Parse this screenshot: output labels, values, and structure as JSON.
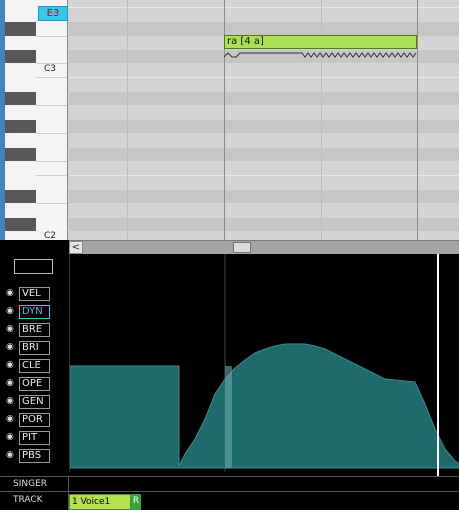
{
  "keyboard": {
    "highlighted_note": "E3",
    "labels": [
      "C3",
      "C2"
    ]
  },
  "note": {
    "lyric": "ra [4 a]"
  },
  "scroll": {
    "left_arrow": "<"
  },
  "control": {
    "params": [
      "VEL",
      "DYN",
      "BRE",
      "BRI",
      "CLE",
      "OPE",
      "GEN",
      "POR",
      "PIT",
      "PBS"
    ],
    "active_param": "DYN"
  },
  "rows": {
    "singer_label": "SINGER",
    "track_label": "TRACK"
  },
  "track": {
    "name": "1 Voice1",
    "r_label": "R"
  },
  "colors": {
    "note_fill": "#aee055",
    "curve_fill": "#1f6a6a",
    "active_param": "#40c4e0",
    "track_tab": "#b2e04e"
  }
}
